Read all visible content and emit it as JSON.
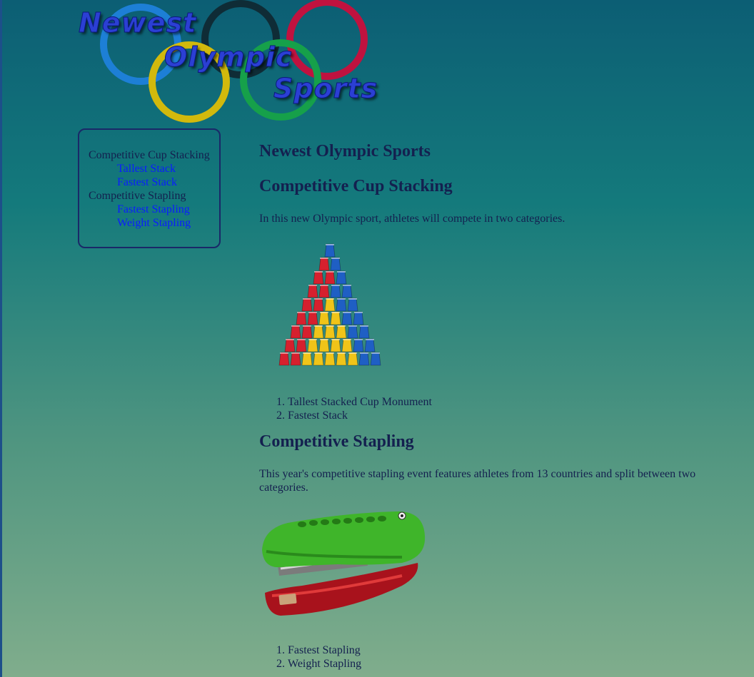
{
  "logo": {
    "words": [
      "Newest",
      "Olympic",
      "Sports"
    ],
    "ring_colors": [
      "#1d7fd6",
      "#0f2c36",
      "#c0123f",
      "#d2b90c",
      "#16a04a"
    ]
  },
  "sidebar": {
    "groups": [
      {
        "label": "Competitive Cup Stacking",
        "links": [
          "Tallest Stack",
          "Fastest Stack"
        ]
      },
      {
        "label": "Competitive Stapling",
        "links": [
          "Fastest Stapling",
          "Weight Stapling"
        ]
      }
    ]
  },
  "main": {
    "site_title": "Newest Olympic Sports",
    "sections": [
      {
        "title": "Competitive Cup Stacking",
        "intro": "In this new Olympic sport, athletes will compete in two categories.",
        "image_icon": "cup-pyramid",
        "list": [
          "Tallest Stacked Cup Monument",
          "Fastest Stack"
        ]
      },
      {
        "title": "Competitive Stapling",
        "intro": "This year's competitive stapling event features athletes from 13 countries and split between two categories.",
        "image_icon": "crocodile-stapler",
        "list": [
          "Fastest Stapling",
          "Weight Stapling"
        ]
      }
    ]
  },
  "colors": {
    "text": "#14204f",
    "link": "#0a1cff",
    "cup_red": "#d6202e",
    "cup_blue": "#1f5fc4",
    "cup_yellow": "#f0c419",
    "stapler_green": "#3fb52a"
  }
}
